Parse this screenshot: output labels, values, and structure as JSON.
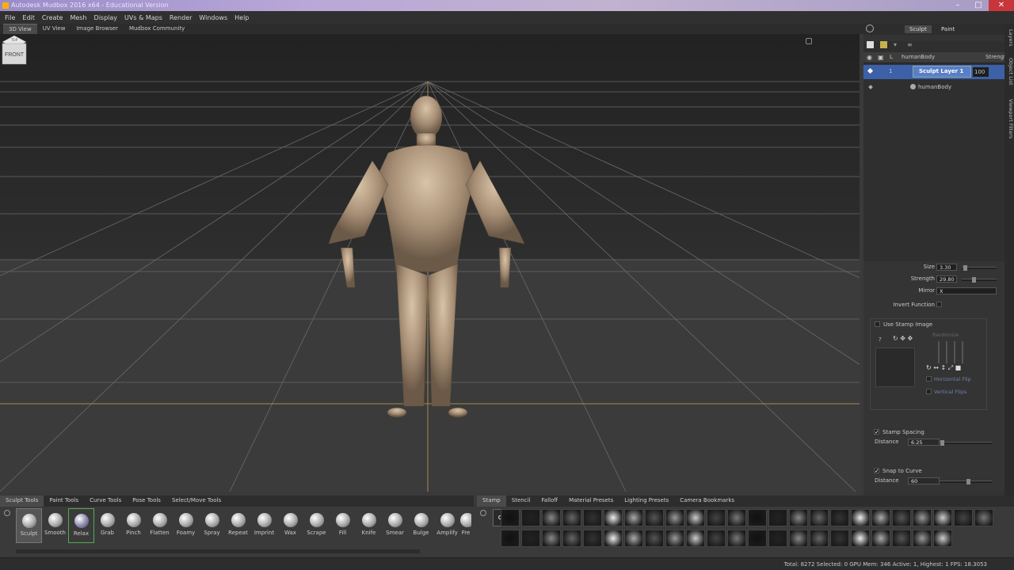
{
  "window": {
    "title": "Autodesk Mudbox 2016 x64 - Educational Version"
  },
  "menu": [
    "File",
    "Edit",
    "Create",
    "Mesh",
    "Display",
    "UVs & Maps",
    "Render",
    "Windows",
    "Help"
  ],
  "view_tabs": [
    "3D View",
    "UV View",
    "Image Browser",
    "Mudbox Community"
  ],
  "viewcube": {
    "face": "FRONT",
    "top": "TOP"
  },
  "panel_tabs": [
    "Sculpt",
    "Paint"
  ],
  "layers": {
    "header_name": "humanBody",
    "header_strength": "Strength",
    "rows": [
      {
        "num": "1",
        "name": "Sculpt Layer 1",
        "strength": "100"
      }
    ],
    "object": "humanBody"
  },
  "props": {
    "size_label": "Size",
    "size_value": "3.30",
    "strength_label": "Strength",
    "strength_value": "29.80",
    "mirror_label": "Mirror",
    "mirror_value": "X",
    "invert_label": "Invert Function",
    "use_stamp_label": "Use Stamp Image",
    "randomize_label": "Randomize",
    "hflip_label": "Horizontal Flip",
    "vflip_label": "Vertical Flips",
    "stamp_spacing_label": "Stamp Spacing",
    "distance_label": "Distance",
    "stamp_distance": "6.25",
    "snap_label": "Snap to Curve",
    "snap_distance": "60"
  },
  "side_tabs": [
    "Layers",
    "Object List",
    "Viewport Filters"
  ],
  "tool_tabs": [
    "Sculpt Tools",
    "Paint Tools",
    "Curve Tools",
    "Pose Tools",
    "Select/Move Tools"
  ],
  "tools": [
    "Sculpt",
    "Smooth",
    "Relax",
    "Grab",
    "Pinch",
    "Flatten",
    "Foamy",
    "Spray",
    "Repeat",
    "Imprint",
    "Wax",
    "Scrape",
    "Fill",
    "Knife",
    "Smear",
    "Bulge",
    "Amplify",
    "Fre"
  ],
  "stamp_tabs": [
    "Stamp",
    "Stencil",
    "Falloff",
    "Material Presets",
    "Lighting Presets",
    "Camera Bookmarks"
  ],
  "stamp_off": "Off",
  "status": "Total: 8272  Selected: 0  GPU Mem: 346  Active: 1, Highest: 1  FPS: 18.3053"
}
